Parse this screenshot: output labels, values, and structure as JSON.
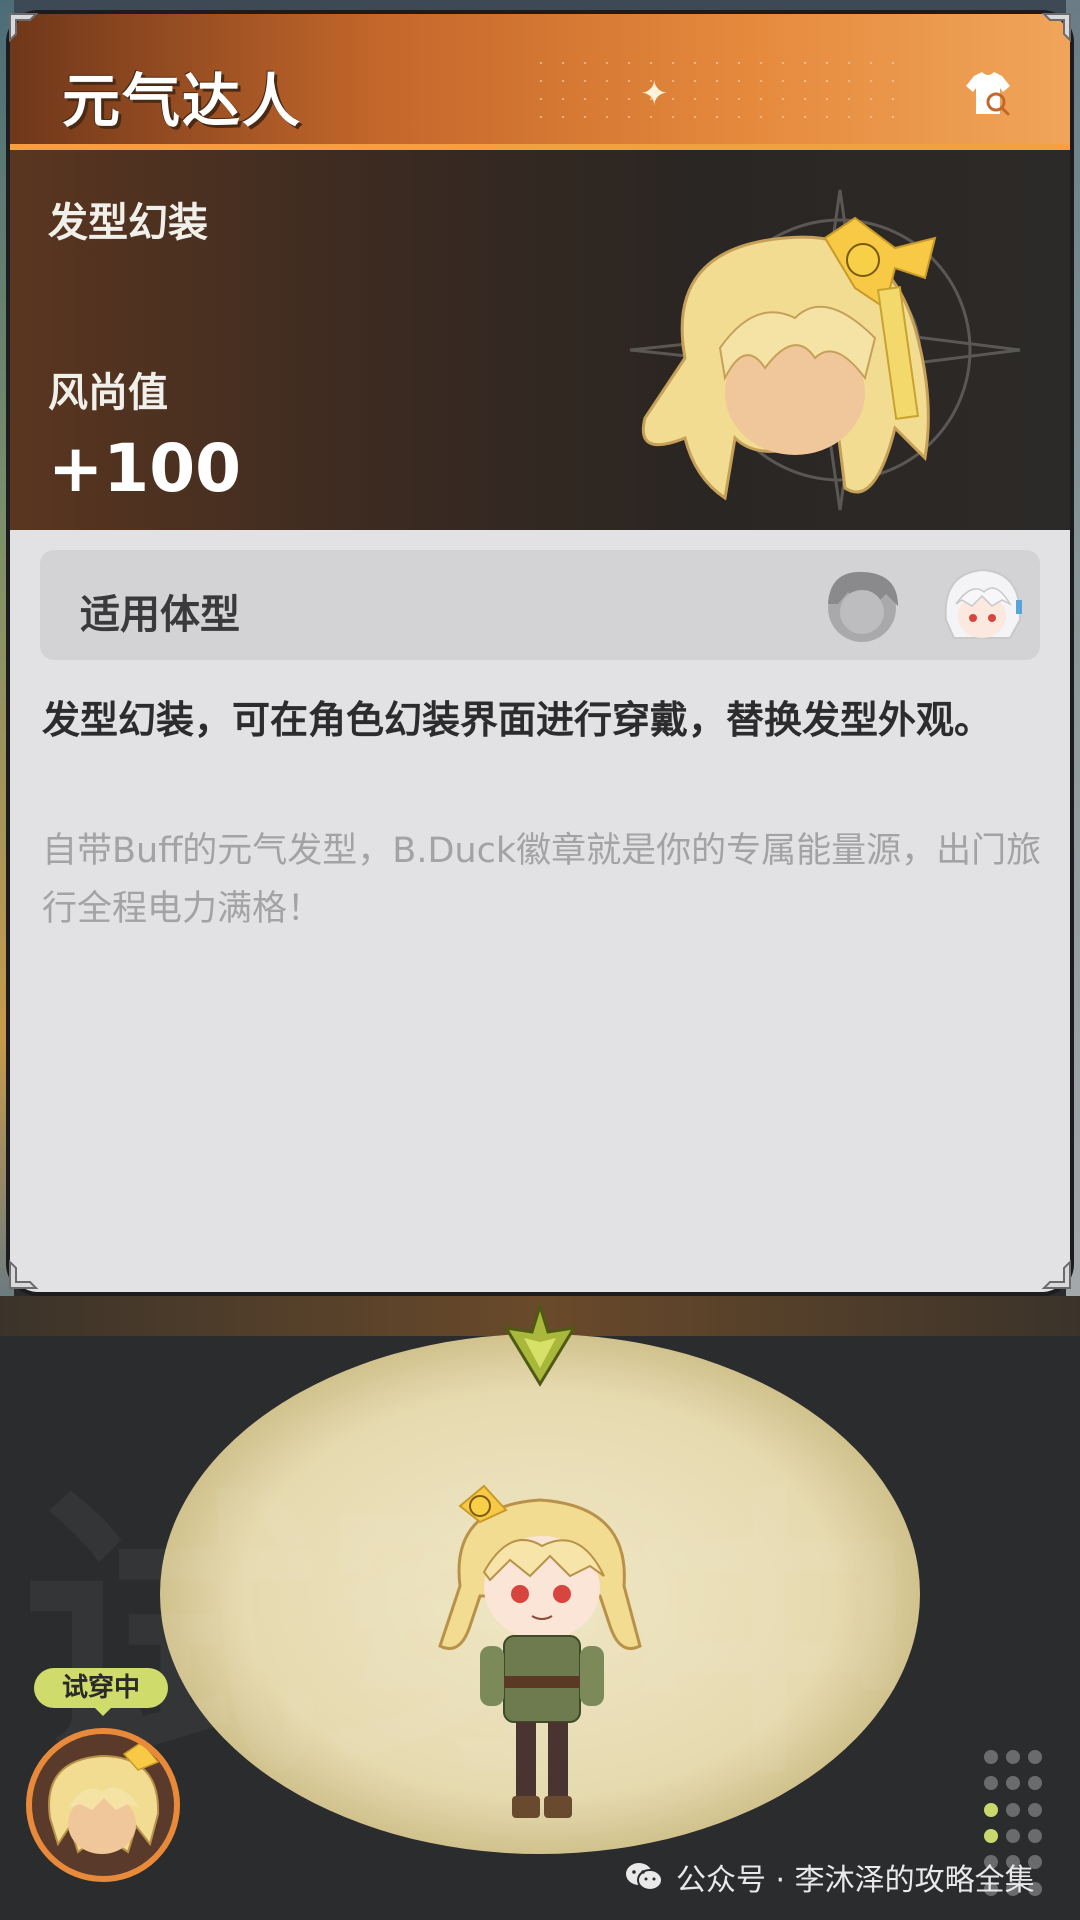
{
  "item": {
    "title": "元气达人",
    "type": "发型幻装",
    "stat_label": "风尚值",
    "stat_value": "+100"
  },
  "body_type": {
    "label": "适用体型",
    "options": [
      {
        "icon": "male-avatar-icon",
        "active": false
      },
      {
        "icon": "female-avatar-icon",
        "active": true
      }
    ]
  },
  "description": {
    "main": "发型幻装，可在角色幻装界面进行穿戴，替换发型外观。",
    "flavor": "自带Buff的元气发型，B.Duck徽章就是你的专属能量源，出门旅行全程电力满格！"
  },
  "stage": {
    "background_text": "试穿中",
    "badge": "试穿中"
  },
  "watermark": {
    "text": "公众号 · 李沐泽的攻略全集"
  },
  "colors": {
    "header_orange": "#e58a3d",
    "accent_lime": "#cfdb6a",
    "card_bg": "#e2e2e4"
  }
}
